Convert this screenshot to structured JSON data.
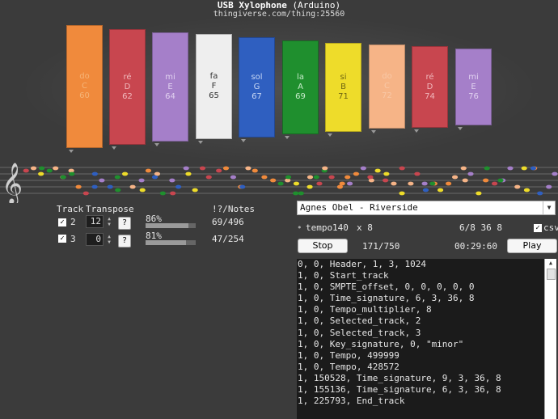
{
  "header": {
    "title_main": "USB Xylophone",
    "title_sub": "(Arduino)",
    "url": "thingiverse.com/thing:25560"
  },
  "bars": [
    {
      "solfege": "do",
      "note": "C",
      "midi": "60",
      "color": "#f08a3c",
      "text_color": "#f5b477"
    },
    {
      "solfege": "ré",
      "note": "D",
      "midi": "62",
      "color": "#c8464f",
      "text_color": "#f0b8bc"
    },
    {
      "solfege": "mi",
      "note": "E",
      "midi": "64",
      "color": "#a57fc9",
      "text_color": "#e0d0ef"
    },
    {
      "solfege": "fa",
      "note": "F",
      "midi": "65",
      "color": "#eeeeee",
      "text_color": "#333333"
    },
    {
      "solfege": "sol",
      "note": "G",
      "midi": "67",
      "color": "#2f5fc0",
      "text_color": "#c7d7f4"
    },
    {
      "solfege": "la",
      "note": "A",
      "midi": "69",
      "color": "#1f8f2e",
      "text_color": "#c6ecca"
    },
    {
      "solfege": "si",
      "note": "B",
      "midi": "71",
      "color": "#eedc2a",
      "text_color": "#6d6412"
    },
    {
      "solfege": "do",
      "note": "C",
      "midi": "72",
      "color": "#f6b487",
      "text_color": "#f8c8a6"
    },
    {
      "solfege": "ré",
      "note": "D",
      "midi": "74",
      "color": "#c8464f",
      "text_color": "#f0b8bc"
    },
    {
      "solfege": "mi",
      "note": "E",
      "midi": "76",
      "color": "#a57fc9",
      "text_color": "#e0d0ef"
    }
  ],
  "tracks": {
    "header_track": "Track",
    "header_transpose": "Transpose",
    "header_notes": "!?/Notes",
    "rows": [
      {
        "number": "2",
        "transpose": "12",
        "help": "?",
        "percent": "86%",
        "progress": 0.86,
        "notes": "69/496",
        "checked": "✓"
      },
      {
        "number": "3",
        "transpose": "0",
        "help": "?",
        "percent": "81%",
        "progress": 0.81,
        "notes": "47/254",
        "checked": "✓"
      }
    ]
  },
  "player": {
    "song": "Agnes Obel - Riverside",
    "tempo_bullet": "•",
    "tempo_label": "tempo",
    "tempo_value": "140",
    "multiplier": "x 8",
    "time_signature": "6/8 36 8",
    "csv_check": "✓",
    "csv_label": "csv",
    "stop_label": "Stop",
    "position": "171/750",
    "time": "00:29:60",
    "play_label": "Play"
  },
  "log_lines": [
    "0, 0, Header, 1, 3, 1024",
    "1, 0, Start_track",
    "1, 0, SMPTE_offset, 0, 0, 0, 0, 0",
    "1, 0, Time_signature, 6, 3, 36, 8",
    "1, 0, Tempo_multiplier, 8",
    "1, 0, Selected_track, 2",
    "1, 0, Selected_track, 3",
    "1, 0, Key_signature, 0, \"minor\"",
    "1, 0, Tempo, 499999",
    "1, 0, Tempo, 428572",
    "1, 150528, Time_signature, 9, 3, 36, 8",
    "1, 155136, Time_signature, 6, 3, 36, 8",
    "1, 225793, End_track"
  ]
}
